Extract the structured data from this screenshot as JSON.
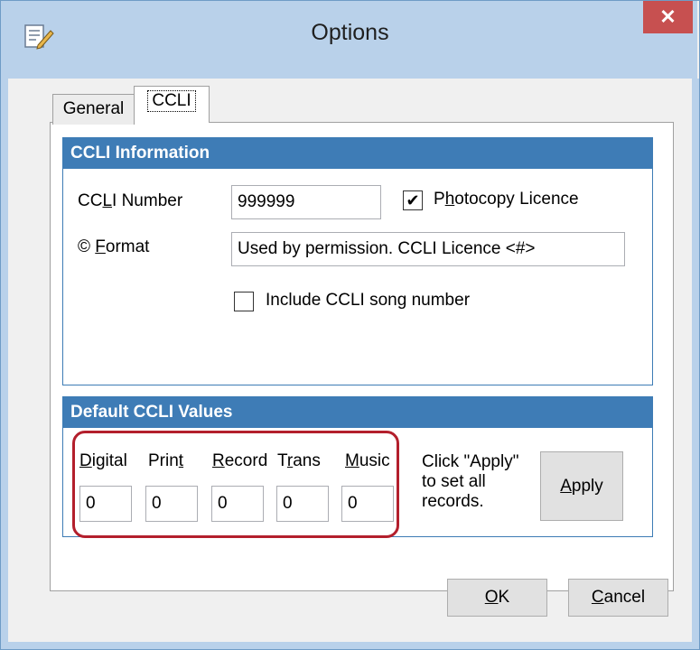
{
  "window": {
    "title": "Options",
    "close_glyph": "✕",
    "app_icon": "options-icon"
  },
  "tabs": [
    {
      "label": "General"
    },
    {
      "label": "CCLI"
    }
  ],
  "ccli_information": {
    "header": "CCLI Information",
    "number_label": "CCLI Number",
    "number_value": "999999",
    "photocopy_label": "Photocopy Licence",
    "photocopy_checked": true,
    "format_label": "© Format",
    "format_value": "Used by permission. CCLI Licence <#>",
    "include_song_number_label": "Include CCLI song number",
    "include_song_number_checked": false
  },
  "default_values": {
    "header": "Default CCLI Values",
    "columns": [
      {
        "label": "Digital",
        "value": "0"
      },
      {
        "label": "Print",
        "value": "0"
      },
      {
        "label": "Record",
        "value": "0"
      },
      {
        "label": "Trans",
        "value": "0"
      },
      {
        "label": "Music",
        "value": "0"
      }
    ],
    "hint": [
      "Click \"Apply\"",
      "to set all",
      "records."
    ],
    "apply_label": "Apply"
  },
  "buttons": {
    "ok_label": "OK",
    "cancel_label": "Cancel"
  },
  "colors": {
    "group_header": "#3e7cb6",
    "title_bar": "#b9d1ea",
    "close_button": "#c75050",
    "highlight": "#b31f2c"
  }
}
